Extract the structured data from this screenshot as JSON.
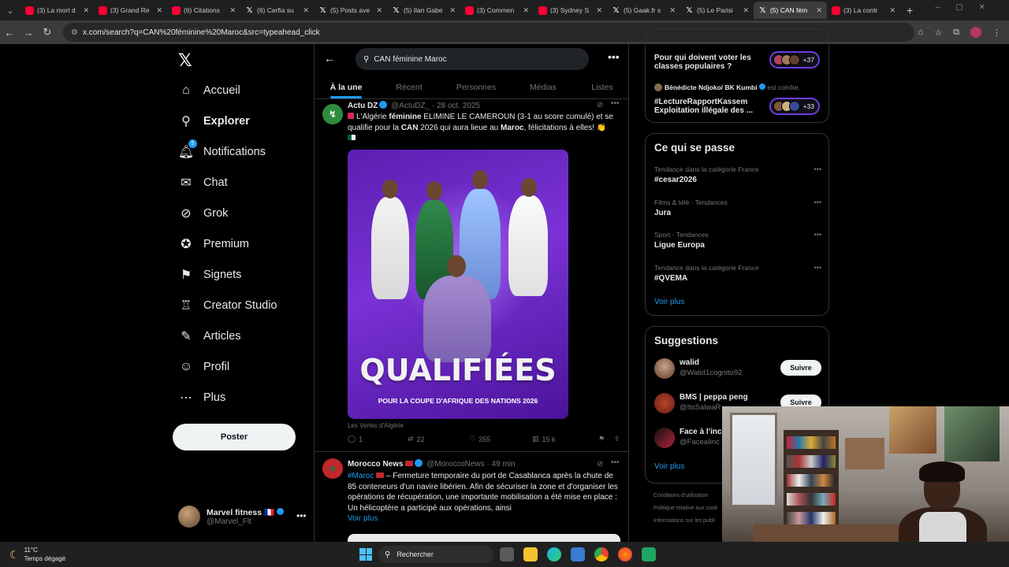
{
  "browser": {
    "tabs": [
      {
        "label": "(3) La mort d",
        "type": "yt"
      },
      {
        "label": "(3) Grand Re",
        "type": "yt"
      },
      {
        "label": "(6) Citations",
        "type": "yt"
      },
      {
        "label": "(6) Cerfia su",
        "type": "x"
      },
      {
        "label": "(5) Posts ave",
        "type": "x"
      },
      {
        "label": "(5) Ilan Gabe",
        "type": "x"
      },
      {
        "label": "(3) Commen",
        "type": "yt"
      },
      {
        "label": "(3) Sydney S",
        "type": "yt"
      },
      {
        "label": "(5) Gaak.fr s",
        "type": "x"
      },
      {
        "label": "(5) Le Parisi",
        "type": "x"
      },
      {
        "label": "(5) CAN fém",
        "type": "x",
        "active": true
      },
      {
        "label": "(3) La contr",
        "type": "yt"
      }
    ],
    "url": "x.com/search?q=CAN%20féminine%20Maroc&src=typeahead_click"
  },
  "nav": {
    "items": [
      {
        "label": "Accueil",
        "icon": "home-icon",
        "glyph": "⌂"
      },
      {
        "label": "Explorer",
        "icon": "search-icon",
        "glyph": "⚲",
        "bold": true
      },
      {
        "label": "Notifications",
        "icon": "bell-icon",
        "glyph": "🔔︎",
        "badge": "5"
      },
      {
        "label": "Chat",
        "icon": "mail-icon",
        "glyph": "✉"
      },
      {
        "label": "Grok",
        "icon": "grok-icon",
        "glyph": "⊘"
      },
      {
        "label": "Premium",
        "icon": "premium-icon",
        "glyph": "✪"
      },
      {
        "label": "Signets",
        "icon": "bookmark-icon",
        "glyph": "⚑"
      },
      {
        "label": "Creator Studio",
        "icon": "creator-icon",
        "glyph": "♖"
      },
      {
        "label": "Articles",
        "icon": "articles-icon",
        "glyph": "✎"
      },
      {
        "label": "Profil",
        "icon": "profile-icon",
        "glyph": "☺"
      },
      {
        "label": "Plus",
        "icon": "more-icon",
        "glyph": "⋯"
      }
    ],
    "post_label": "Poster",
    "account": {
      "name": "Marvel fitness",
      "handle": "@Marvel_Flt"
    }
  },
  "search": {
    "query": "CAN féminine Maroc",
    "tabs": [
      "À la une",
      "Récent",
      "Personnes",
      "Médias",
      "Listes"
    ]
  },
  "tweet1": {
    "name": "Actu DZ",
    "handle": "@ActuDZ_",
    "date": "· 28 oct. 2025",
    "text_a": "L'Algérie ",
    "text_b": "féminine",
    "text_c": " ELIMINE LE CAMEROUN (3-1 au score cumulé) et se qualifie pour la ",
    "text_d": "CAN",
    "text_e": " 2026 qui aura lieue au ",
    "text_f": "Maroc",
    "text_g": ", félicitations à elles! 👏",
    "image_title": "QUALIFIÉES",
    "image_subtitle": "POUR LA COUPE D'AFRIQUE DES NATIONS 2026",
    "caption": "Les Vertes d'Algérie",
    "stats": {
      "replies": "1",
      "reposts": "22",
      "likes": "355",
      "views": "15 k"
    }
  },
  "tweet2": {
    "name": "Morocco News",
    "handle": "@MoroccoNews",
    "date": "· 49 min",
    "hashtag": "#Maroc",
    "text": " – Fermeture temporaire du port de Casablanca après la chute de 85 conteneurs d'un navire libérien. Afin de sécuriser la zone et d'organiser les opérations de récupération, une importante mobilisation a été mise en place : Un hélicoptère a participé aux opérations, ainsi",
    "more": "Voir plus"
  },
  "spaces": {
    "q1": "Pour qui doivent voter les classes populaires ?",
    "q1_count": "+37",
    "host": "Bénédicte Ndjoko/ BK Kumbi",
    "host_suffix": "est cohôte.",
    "q2": "#LectureRapportKassem Exploitation illégale des ...",
    "q2_count": "+33"
  },
  "trends": {
    "title": "Ce qui se passe",
    "items": [
      {
        "context": "Tendance dans la catégorie France",
        "name": "#cesar2026"
      },
      {
        "context": "Films & télé · Tendances",
        "name": "Jura"
      },
      {
        "context": "Sport · Tendances",
        "name": "Ligue Europa"
      },
      {
        "context": "Tendance dans la catégorie France",
        "name": "#QVEMA"
      }
    ],
    "more": "Voir plus"
  },
  "suggestions": {
    "title": "Suggestions",
    "items": [
      {
        "name": "walid",
        "handle": "@Walid1cognito92"
      },
      {
        "name": "BMS | peppa peng",
        "handle": "@ItsSalwaR"
      },
      {
        "name": "Face à l'ince",
        "handle": "@FaceaIinc"
      }
    ],
    "follow_label": "Suivre",
    "more": "Voir plus"
  },
  "footer": [
    "Conditions d'utilisation",
    "Politique relative aux cook",
    "Informations sur les publi"
  ],
  "taskbar": {
    "temp": "11°C",
    "weather": "Temps dégagé",
    "search": "Rechercher"
  },
  "colors": {
    "accent": "#1d9bf0",
    "bg": "#000000",
    "muted": "#71767b"
  }
}
